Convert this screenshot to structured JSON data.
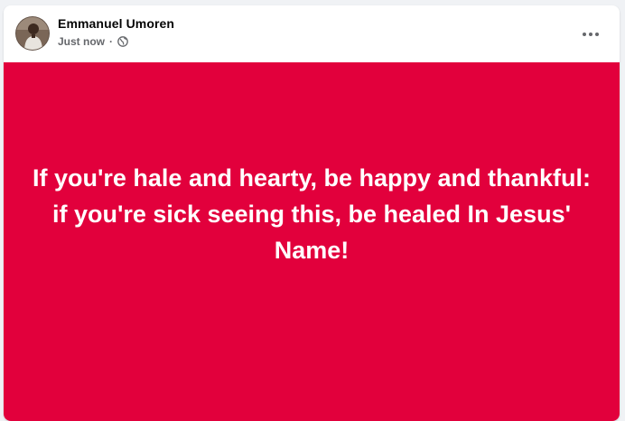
{
  "post": {
    "author_name": "Emmanuel Umoren",
    "timestamp": "Just now",
    "separator": "·",
    "privacy_icon": "globe-icon",
    "more_icon": "more-horizontal-icon",
    "background_color": "#e2003c",
    "text_color": "#ffffff",
    "text": "If you're hale and hearty, be happy and thankful: if you're sick seeing this, be healed In Jesus' Name!"
  }
}
